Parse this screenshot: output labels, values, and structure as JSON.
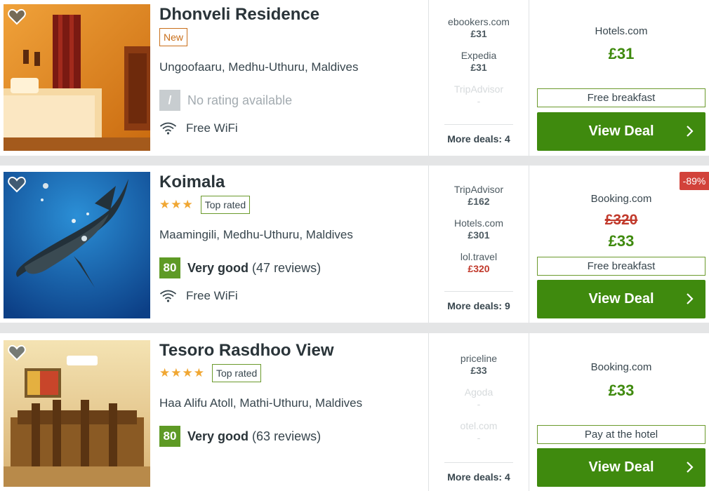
{
  "colors": {
    "accent": "#3f8a0e",
    "score": "#5e9a25",
    "discount": "#d2423a",
    "strike": "#c1392b"
  },
  "hotels": [
    {
      "name": "Dhonveli Residence",
      "badge": "New",
      "stars": "",
      "location": "Ungoofaaru, Medhu-Uthuru, Maldives",
      "score": "/",
      "rating_label": "No rating available",
      "reviews": "",
      "amenity": "Free WiFi",
      "deals": [
        {
          "name": "ebookers.com",
          "price": "£31"
        },
        {
          "name": "Expedia",
          "price": "£31"
        },
        {
          "name": "TripAdvisor",
          "price": "-"
        }
      ],
      "more_deals": "More deals: 4",
      "provider": "Hotels.com",
      "old_price": "",
      "price": "£31",
      "perk": "Free breakfast",
      "cta": "View Deal"
    },
    {
      "name": "Koimala",
      "badge": "Top rated",
      "stars": "★★★",
      "location": "Maamingili, Medhu-Uthuru, Maldives",
      "score": "80",
      "rating_label": "Very good",
      "reviews": "(47 reviews)",
      "amenity": "Free WiFi",
      "deals": [
        {
          "name": "TripAdvisor",
          "price": "£162"
        },
        {
          "name": "Hotels.com",
          "price": "£301"
        },
        {
          "name": "lol.travel",
          "price": "£320"
        }
      ],
      "more_deals": "More deals: 9",
      "discount": "-89%",
      "provider": "Booking.com",
      "old_price": "£320",
      "price": "£33",
      "perk": "Free breakfast",
      "cta": "View Deal"
    },
    {
      "name": "Tesoro Rasdhoo View",
      "badge": "Top rated",
      "stars": "★★★★",
      "location": "Haa Alifu Atoll, Mathi-Uthuru, Maldives",
      "score": "80",
      "rating_label": "Very good",
      "reviews": "(63 reviews)",
      "amenity": "",
      "deals": [
        {
          "name": "priceline",
          "price": "£33"
        },
        {
          "name": "Agoda",
          "price": "-"
        },
        {
          "name": "otel.com",
          "price": "-"
        }
      ],
      "more_deals": "More deals: 4",
      "provider": "Booking.com",
      "old_price": "",
      "price": "£33",
      "perk": "Pay at the hotel",
      "cta": "View Deal"
    }
  ]
}
